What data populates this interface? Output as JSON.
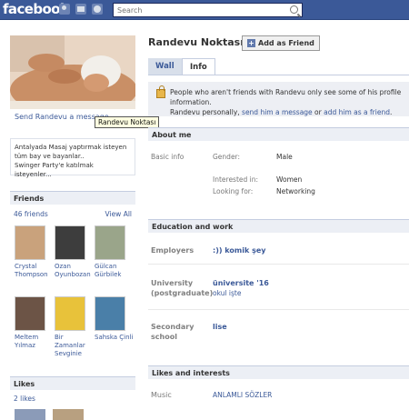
{
  "topbar": {
    "logo": "facebook",
    "search_placeholder": "Search"
  },
  "profile": {
    "name": "Randevu Noktası",
    "add_friend_label": "Add as Friend",
    "send_message_label": "Send Randevu a message",
    "tooltip": "Randevu Noktası",
    "bio_lines": [
      "Antalyada Masaj yaptırmak isteyen",
      "tüm bay ve bayanlar..",
      "Swinger Party'e katılmak isteyenler..."
    ]
  },
  "tabs": [
    {
      "label": "Wall",
      "active": false
    },
    {
      "label": "Info",
      "active": true
    }
  ],
  "notice": {
    "line1": "People who aren't friends with Randevu only see some of his profile information.",
    "line2_pre": "Randevu personally, ",
    "line2_link1": "send him a message",
    "line2_mid": " or ",
    "line2_link2": "add him as a friend",
    "line2_post": "."
  },
  "friends": {
    "header": "Friends",
    "count_label": "46 friends",
    "view_all": "View All",
    "items": [
      {
        "name_l1": "Crystal",
        "name_l2": "Thompson",
        "color": "#c9a27c"
      },
      {
        "name_l1": "Ozan",
        "name_l2": "Oyunbozan",
        "color": "#3d3d3d"
      },
      {
        "name_l1": "Gülcan",
        "name_l2": "Gürbilek",
        "color": "#9aa58a"
      },
      {
        "name_l1": "Meltem",
        "name_l2": "Yılmaz",
        "color": "#6c5446"
      },
      {
        "name_l1": "Bir",
        "name_l2": "Zamanlar",
        "name_l3": "Sevginie",
        "color": "#e8c23a"
      },
      {
        "name_l1": "Sahska Çinli",
        "name_l2": "",
        "color": "#4a7fa8"
      }
    ]
  },
  "likes": {
    "header": "Likes",
    "count_label": "2 likes"
  },
  "about": {
    "header": "About me",
    "basic_info_label": "Basic info",
    "gender_label": "Gender:",
    "gender_value": "Male",
    "interested_label": "Interested in:",
    "interested_value": "Women",
    "looking_label": "Looking for:",
    "looking_value": "Networking"
  },
  "education": {
    "header": "Education and work",
    "employers_label": "Employers",
    "employers_value": ":)) komik şey",
    "university_label_l1": "University",
    "university_label_l2": "(postgraduate)",
    "university_value": "üniversite '16",
    "university_sub": "okul işte",
    "secondary_label_l1": "Secondary",
    "secondary_label_l2": "school",
    "secondary_value": "lise"
  },
  "likes_interests": {
    "header": "Likes and interests",
    "music_label": "Music",
    "music_value": "ANLAMLI SÖZLER"
  },
  "colors": {
    "brand": "#3b5998",
    "section_bg": "#eceff5",
    "notice_bg": "#edeff4"
  }
}
